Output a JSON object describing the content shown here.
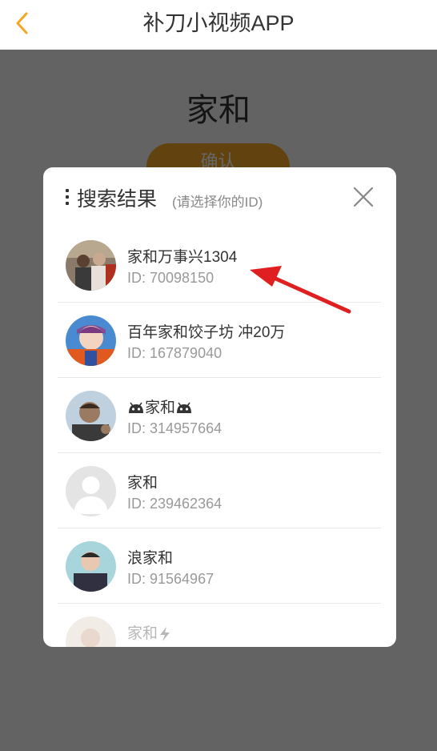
{
  "header": {
    "title": "补刀小视频APP",
    "back_icon": "chevron-left-icon",
    "accent": "#f5a623"
  },
  "background": {
    "name": "家和",
    "confirm_label": "确认"
  },
  "modal": {
    "title": "搜索结果",
    "subtitle": "(请选择你的ID)",
    "close_icon": "close-icon",
    "results": [
      {
        "name": "家和万事兴1304",
        "id": "ID: 70098150"
      },
      {
        "name": "百年家和饺子坊 冲20万",
        "id": "ID: 167879040"
      },
      {
        "name": "家和",
        "id": "ID: 314957664",
        "name_prefix_icon": "android-icon",
        "name_suffix_icon": "android-icon"
      },
      {
        "name": "家和",
        "id": "ID: 239462364"
      },
      {
        "name": "浪家和",
        "id": "ID: 91564967"
      },
      {
        "name": "家和",
        "name_suffix_icon": "lightning-icon"
      }
    ]
  },
  "annotation": {
    "arrow_color": "#e02020"
  }
}
